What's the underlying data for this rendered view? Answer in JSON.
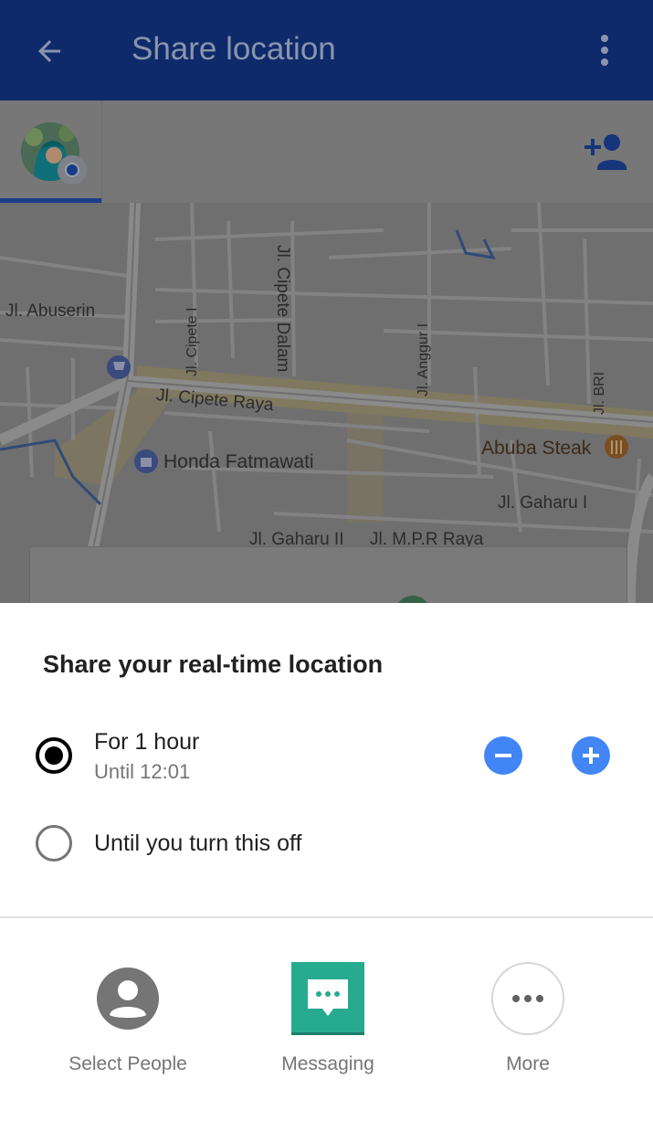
{
  "app_bar": {
    "title": "Share location",
    "back_icon": "arrow-back-icon",
    "menu_icon": "more-vert-icon",
    "color": "#0f2a6a"
  },
  "people_strip": {
    "add_person_icon": "person-add-icon"
  },
  "map": {
    "labels": {
      "abuserin": "Jl. Abuserin",
      "cipete_raya": "Jl. Cipete Raya",
      "cipete_dalam": "Jl. Cipete Dalam",
      "cipete_i": "Jl. Cipete I",
      "anggur": "Jl. Anggur I",
      "bri": "Jl. BRI",
      "gaharu_i": "Jl. Gaharu I",
      "gaharu_ii": "Jl. Gaharu II",
      "mpr": "Jl. M.P.R Raya"
    },
    "pois": {
      "honda": "Honda Fatmawati",
      "abuba": "Abuba Steak"
    }
  },
  "sheet": {
    "heading": "Share your real-time location",
    "options": [
      {
        "label": "For 1 hour",
        "sublabel": "Until 12:01",
        "selected": true
      },
      {
        "label": "Until you turn this off",
        "selected": false
      }
    ],
    "accent_color": "#4285f4"
  },
  "share_targets": [
    {
      "label": "Select People",
      "icon": "account-circle-icon"
    },
    {
      "label": "Messaging",
      "icon": "messaging-icon"
    },
    {
      "label": "More",
      "icon": "more-horiz-icon"
    }
  ]
}
